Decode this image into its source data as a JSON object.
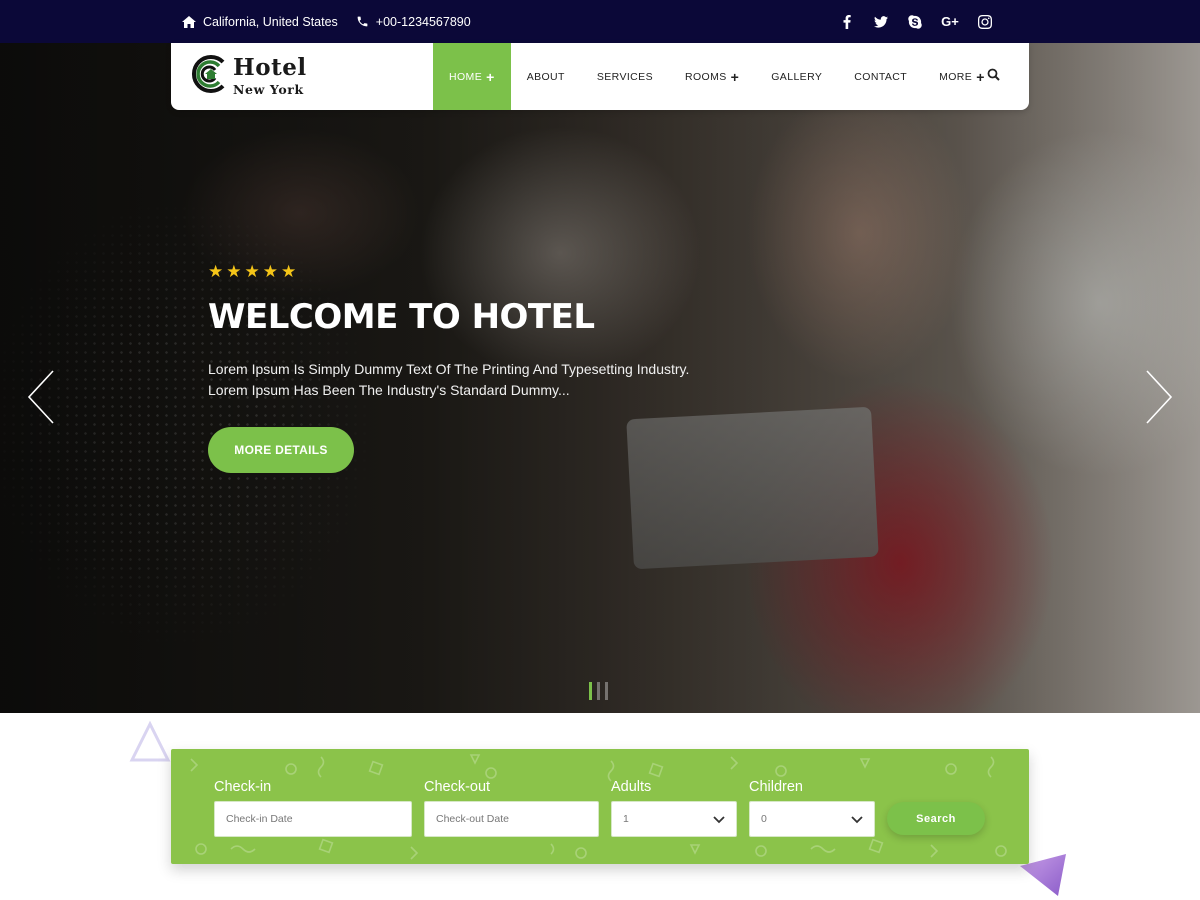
{
  "topbar": {
    "location": "California, United States",
    "phone": "+00-1234567890",
    "social": [
      "facebook-icon",
      "twitter-icon",
      "skype-icon",
      "google-plus-icon",
      "instagram-icon"
    ],
    "gplus_label": "G+"
  },
  "logo": {
    "name": "Hotel",
    "city": "New York"
  },
  "nav": {
    "items": [
      {
        "label": "HOME",
        "has_plus": true,
        "active": true
      },
      {
        "label": "ABOUT",
        "has_plus": false
      },
      {
        "label": "SERVICES",
        "has_plus": false
      },
      {
        "label": "ROOMS",
        "has_plus": true
      },
      {
        "label": "GALLERY",
        "has_plus": false
      },
      {
        "label": "CONTACT",
        "has_plus": false
      },
      {
        "label": "MORE",
        "has_plus": true
      }
    ],
    "plus_symbol": "+"
  },
  "hero": {
    "rating": 5,
    "star_glyph": "★",
    "title": "WELCOME TO HOTEL",
    "description": "Lorem Ipsum Is Simply Dummy Text Of The Printing And Typesetting Industry. Lorem Ipsum Has Been The Industry's Standard Dummy...",
    "button_label": "MORE DETAILS",
    "slides": 3,
    "active_slide": 1
  },
  "booking": {
    "checkin_label": "Check-in",
    "checkin_placeholder": "Check-in Date",
    "checkout_label": "Check-out",
    "checkout_placeholder": "Check-out Date",
    "adults_label": "Adults",
    "adults_value": "1",
    "children_label": "Children",
    "children_value": "0",
    "search_label": "Search"
  },
  "colors": {
    "topbar_bg": "#0b0838",
    "accent_green": "#7cc14a",
    "booking_bg": "#8bc34a",
    "star_yellow": "#f5c518"
  }
}
